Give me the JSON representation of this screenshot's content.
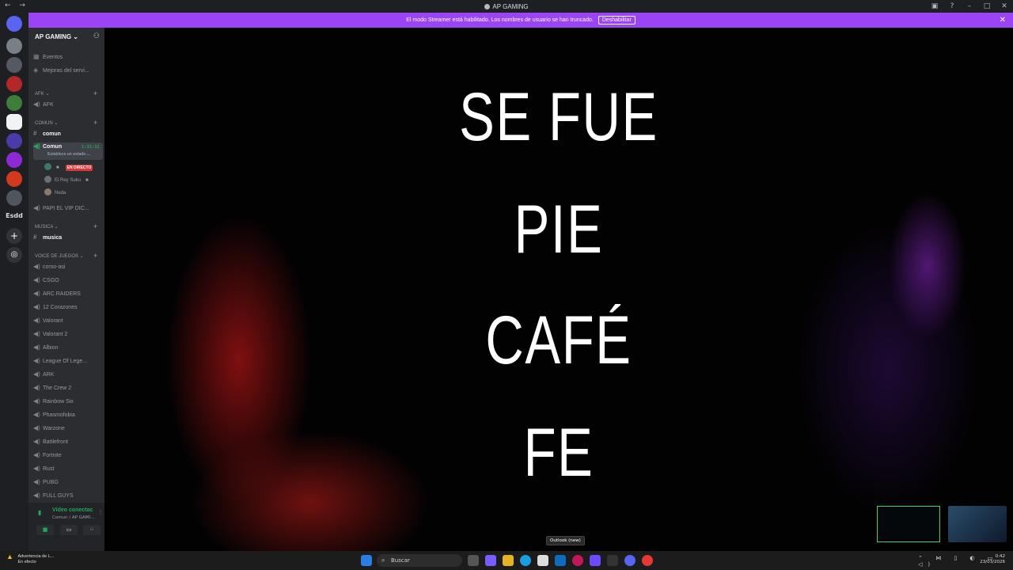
{
  "window": {
    "title": "AP GAMING"
  },
  "banner": {
    "text": "El modo Streamer está habilitado. Los nombres de usuario se han truncado.",
    "button": "Deshabilitar"
  },
  "rail": {
    "label": "Esdd"
  },
  "server": {
    "name": "AP GAMING ⌄"
  },
  "top_items": [
    "Eventos",
    "Mejoras del servi..."
  ],
  "categories": [
    "AFK",
    "COMUN",
    "MUSICA",
    "VOICE DE JUEGOS"
  ],
  "afk_channel": "AFK",
  "comun": {
    "text_channel": "comun",
    "voice_channel": "Comun",
    "timer": "1:31:31",
    "status": "Establece un estado ...",
    "users": [
      {
        "name": "",
        "badge": "EN DIRECTO"
      },
      {
        "name": "El Rey Suku"
      },
      {
        "name": "Neda"
      }
    ],
    "extra_channel": "PAPI EL VIP DIC..."
  },
  "musica": {
    "text_channel": "musica"
  },
  "game_channels": [
    "como-asi",
    "CSGO",
    "ARC RAIDERS",
    "12 Corazones",
    "Valorant",
    "Valorant 2",
    "Albion",
    "League Of Lege...",
    "ARK",
    "The Crew 2",
    "Rainbow Six",
    "Phasmofobia",
    "Warzone",
    "Battlefront",
    "Fortnite",
    "Rust",
    "PUBG",
    "FULL GUYS"
  ],
  "voice": {
    "status": "Vídeo conectac",
    "server": "Comun / AP GAMI..."
  },
  "lyrics": [
    "SE FUE",
    "PIE",
    "CAFÉ",
    "FE"
  ],
  "taskbar": {
    "warning_title": "Advertencia de L...",
    "warning_sub": "En efecto",
    "search": "Buscar",
    "tooltip": "Outlook (new)",
    "time": "0:42",
    "date": "23/03/2026"
  },
  "colors": {
    "accent": "#9b44f5",
    "voice_green": "#23a55a",
    "live_red": "#da373c"
  }
}
